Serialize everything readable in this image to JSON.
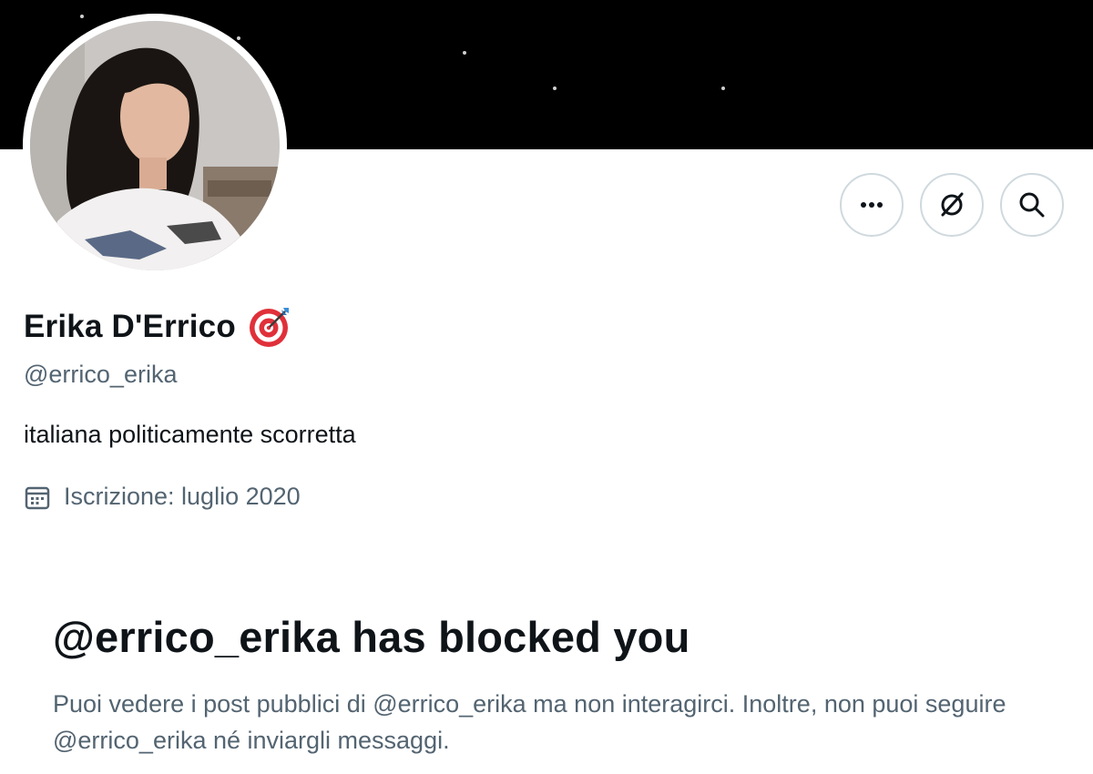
{
  "profile": {
    "display_name": "Erika D'Errico",
    "name_emoji": "🎯",
    "handle": "@errico_erika",
    "bio": "italiana politicamente scorretta",
    "joined": "Iscrizione: luglio 2020"
  },
  "actions": {
    "more_icon": "more-horizontal-icon",
    "grok_icon": "grok-icon",
    "search_icon": "search-icon"
  },
  "blocked": {
    "title": "@errico_erika has blocked you",
    "description": "Puoi vedere i post pubblici di @errico_erika ma non interagirci. Inoltre, non puoi seguire @errico_erika né inviargli messaggi."
  },
  "colors": {
    "text_primary": "#0f1419",
    "text_secondary": "#536471",
    "border": "#cfd9de",
    "banner": "#000000"
  }
}
